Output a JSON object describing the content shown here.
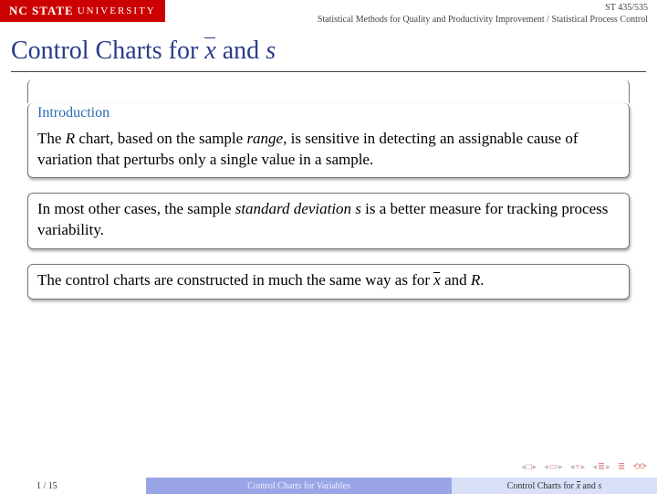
{
  "header": {
    "logo_bold": "NC STATE",
    "logo_light": "UNIVERSITY",
    "course_code": "ST 435/535",
    "course_path": "Statistical Methods for Quality and Productivity Improvement / Statistical Process Control"
  },
  "title": {
    "prefix": "Control Charts for ",
    "xbar": "x",
    "suffix": " and ",
    "s": "s"
  },
  "intro_label": "Introduction",
  "blocks": {
    "b1_p1": "The ",
    "b1_R": "R",
    "b1_p2": " chart, based on the sample ",
    "b1_range": "range",
    "b1_p3": ", is sensitive in detecting an assignable cause of variation that perturbs only a single value in a sample.",
    "b2_p1": "In most other cases, the sample ",
    "b2_sd": "standard deviation s",
    "b2_p2": " is a better measure for tracking process variability.",
    "b3_p1": "The control charts are constructed in much the same way as for ",
    "b3_xbar": "x",
    "b3_p2": " and ",
    "b3_R": "R",
    "b3_p3": "."
  },
  "footer": {
    "page": "1 / 15",
    "section": "Control Charts for Variables",
    "sub_prefix": "Control Charts for ",
    "sub_xbar": "x",
    "sub_mid": " and ",
    "sub_s": "s"
  }
}
